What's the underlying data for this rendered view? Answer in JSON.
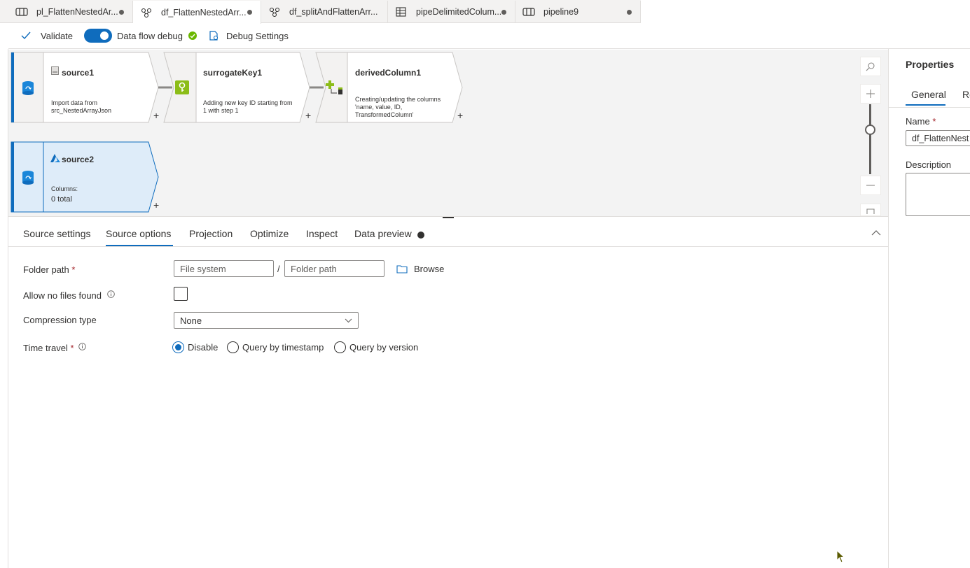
{
  "tabs": [
    {
      "label": "pl_FlattenNestedAr...",
      "icon": "pipeline-icon",
      "active": false
    },
    {
      "label": "df_FlattenNestedArr...",
      "icon": "dataflow-icon",
      "active": true
    },
    {
      "label": "df_splitAndFlattenArr...",
      "icon": "dataflow-icon",
      "active": false
    },
    {
      "label": "pipeDelimitedColum...",
      "icon": "table-icon",
      "active": false
    },
    {
      "label": "pipeline9",
      "icon": "pipeline-icon",
      "active": false
    }
  ],
  "toolbar": {
    "validate_label": "Validate",
    "debug_label": "Data flow debug",
    "debug_settings_label": "Debug Settings"
  },
  "canvas": {
    "nodes": [
      {
        "title": "source1",
        "desc": "Import data from src_NestedArrayJson"
      },
      {
        "title": "surrogateKey1",
        "desc": "Adding new key ID starting from 1 with step 1"
      },
      {
        "title": "derivedColumn1",
        "desc": "Creating/updating the columns 'name, value, ID, TransformedColumn'"
      },
      {
        "title": "source2",
        "columns_label": "Columns:",
        "columns_total": "0 total"
      }
    ],
    "plus": "+"
  },
  "bottom_tabs": [
    "Source settings",
    "Source options",
    "Projection",
    "Optimize",
    "Inspect",
    "Data preview"
  ],
  "active_bottom_tab": "Source options",
  "form": {
    "folder_path_label": "Folder path",
    "required_mark": "*",
    "file_system_placeholder": "File system",
    "separator": "/",
    "folder_path_placeholder": "Folder path",
    "browse_label": "Browse",
    "allow_no_files_label": "Allow no files found",
    "compression_label": "Compression type",
    "compression_value": "None",
    "time_travel_label": "Time travel",
    "time_travel_options": [
      "Disable",
      "Query by timestamp",
      "Query by version"
    ],
    "time_travel_selected": "Disable"
  },
  "properties": {
    "title": "Properties",
    "tab_general": "General",
    "tab_related": "Re",
    "name_label": "Name",
    "name_value": "df_FlattenNest",
    "description_label": "Description"
  },
  "colors": {
    "accent": "#0f6cbd",
    "debug_ok": "#6bb700",
    "canvas_bg": "#f3f3f3",
    "selected_node": "#deecf9"
  }
}
